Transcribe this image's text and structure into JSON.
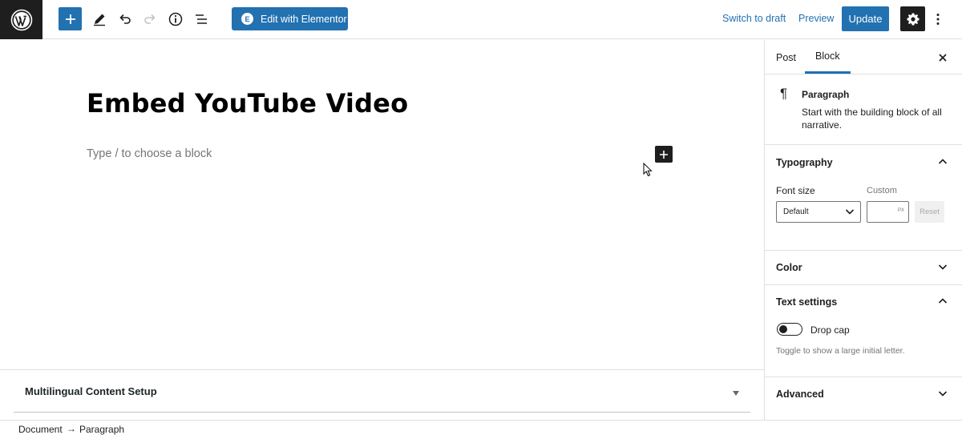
{
  "toolbar": {
    "logo_icon": "wordpress-icon",
    "add_block_icon": "plus-icon",
    "tools_icon": "pencil-icon",
    "undo_icon": "undo-icon",
    "redo_icon": "redo-icon",
    "details_icon": "info-icon",
    "list_view_icon": "list-view-icon",
    "elementor_badge": "E",
    "elementor_label": "Edit with Elementor",
    "switch_to_draft_label": "Switch to draft",
    "preview_label": "Preview",
    "update_label": "Update",
    "settings_icon": "gear-icon",
    "more_icon": "more-vertical-icon",
    "accent_color": "#2271b1"
  },
  "editor": {
    "title": "Embed YouTube Video",
    "placeholder": "Type / to choose a block",
    "inserter_icon": "plus-icon"
  },
  "metabox": {
    "title": "Multilingual Content Setup"
  },
  "breadcrumb": {
    "items": [
      "Document",
      "Paragraph"
    ],
    "separator": "→"
  },
  "sidebar": {
    "tabs": [
      {
        "label": "Post",
        "active": false
      },
      {
        "label": "Block",
        "active": true
      }
    ],
    "block": {
      "icon": "paragraph-icon",
      "symbol": "¶",
      "name": "Paragraph",
      "description": "Start with the building block of all narrative."
    },
    "typography": {
      "title": "Typography",
      "expanded": true,
      "font_size_label": "Font size",
      "custom_label": "Custom",
      "font_size_value": "Default",
      "custom_unit": "PX",
      "reset_label": "Reset"
    },
    "color": {
      "title": "Color",
      "expanded": false
    },
    "text_settings": {
      "title": "Text settings",
      "expanded": true,
      "drop_cap_label": "Drop cap",
      "drop_cap_enabled": false,
      "drop_cap_help": "Toggle to show a large initial letter."
    },
    "advanced": {
      "title": "Advanced",
      "expanded": false
    }
  }
}
